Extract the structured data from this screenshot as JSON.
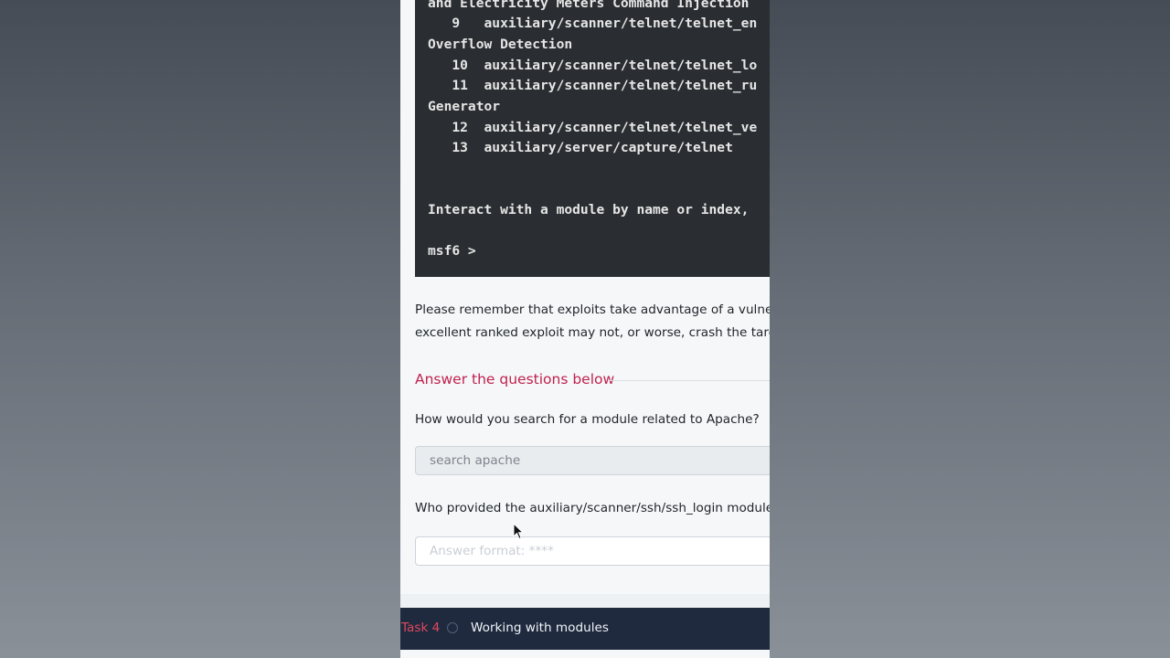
{
  "terminal": {
    "lines": [
      "and Electricity Meters Command Injection",
      "   9   auxiliary/scanner/telnet/telnet_en",
      "Overflow Detection",
      "   10  auxiliary/scanner/telnet/telnet_lo",
      "   11  auxiliary/scanner/telnet/telnet_ru",
      "Generator",
      "   12  auxiliary/scanner/telnet/telnet_ve",
      "   13  auxiliary/server/capture/telnet",
      "Interact with a module by name or index,",
      "msf6 >"
    ]
  },
  "paragraph": {
    "line1": "Please remember that exploits take advantage of a vulnerabilit",
    "line2": "excellent ranked exploit may not, or worse, crash the target sy"
  },
  "questions": {
    "section_title": "Answer the questions below",
    "q1": {
      "text": "How would you search for a module related to Apache?",
      "answer": "search apache"
    },
    "q2": {
      "text": "Who provided the auxiliary/scanner/ssh/ssh_login module?",
      "placeholder": "Answer format: ****"
    }
  },
  "task_bar": {
    "number": "Task 4",
    "title": "Working with modules"
  },
  "colors": {
    "accent": "#c0214f",
    "terminal_bg": "#2a2d31",
    "task_bar_bg": "#1f2a3f"
  }
}
